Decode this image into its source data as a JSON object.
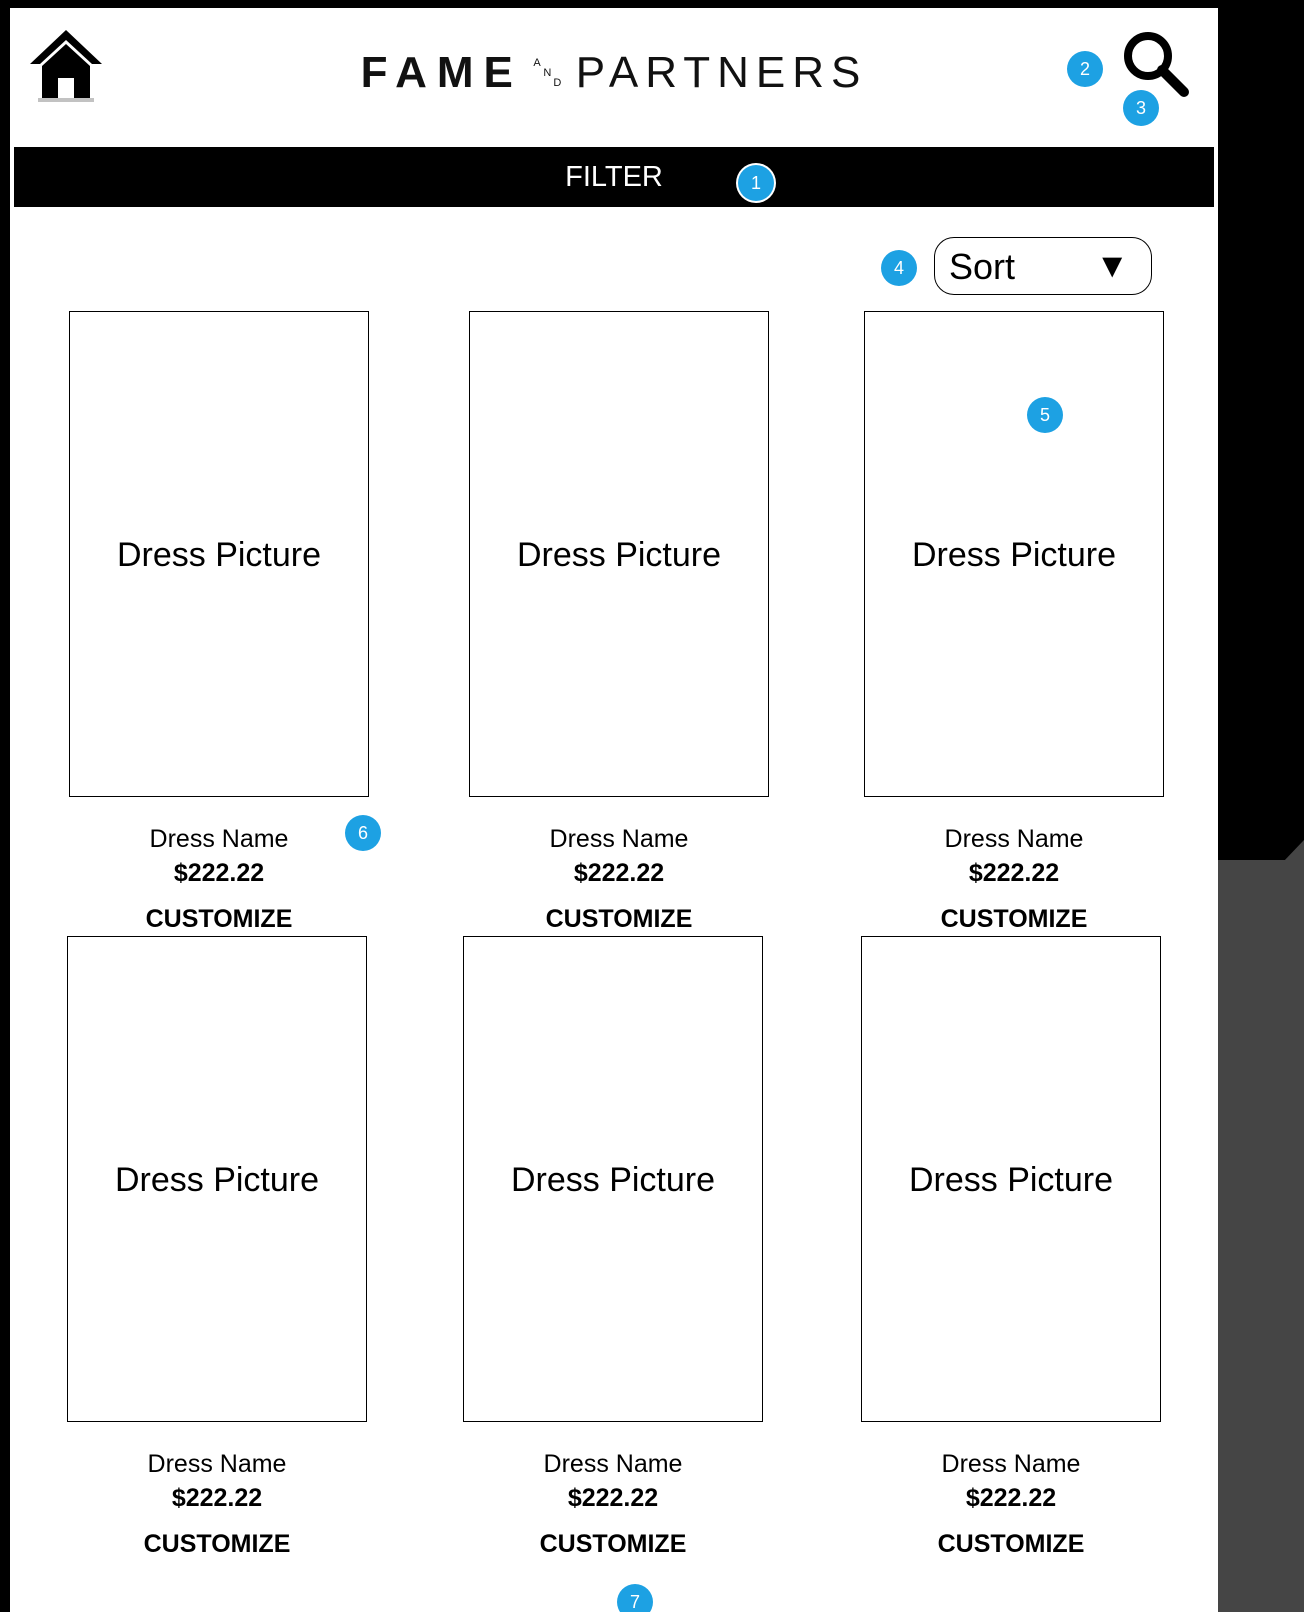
{
  "header": {
    "logo_primary": "FAME",
    "logo_and": [
      "A",
      "N",
      "D"
    ],
    "logo_secondary": "PARTNERS"
  },
  "filter_bar": {
    "label": "FILTER"
  },
  "sort": {
    "label": "Sort",
    "arrow": "▼"
  },
  "products": [
    {
      "picture_label": "Dress Picture",
      "name": "Dress Name",
      "price": "$222.22",
      "action": "CUSTOMIZE"
    },
    {
      "picture_label": "Dress Picture",
      "name": "Dress Name",
      "price": "$222.22",
      "action": "CUSTOMIZE"
    },
    {
      "picture_label": "Dress Picture",
      "name": "Dress Name",
      "price": "$222.22",
      "action": "CUSTOMIZE"
    },
    {
      "picture_label": "Dress Picture",
      "name": "Dress Name",
      "price": "$222.22",
      "action": "CUSTOMIZE"
    },
    {
      "picture_label": "Dress Picture",
      "name": "Dress Name",
      "price": "$222.22",
      "action": "CUSTOMIZE"
    },
    {
      "picture_label": "Dress Picture",
      "name": "Dress Name",
      "price": "$222.22",
      "action": "CUSTOMIZE"
    }
  ],
  "annotations": [
    "1",
    "2",
    "3",
    "4",
    "5",
    "6",
    "7"
  ],
  "icons": {
    "home": "home-icon",
    "search": "search-icon"
  },
  "colors": {
    "badge": "#1da1e3",
    "bar": "#000000"
  }
}
